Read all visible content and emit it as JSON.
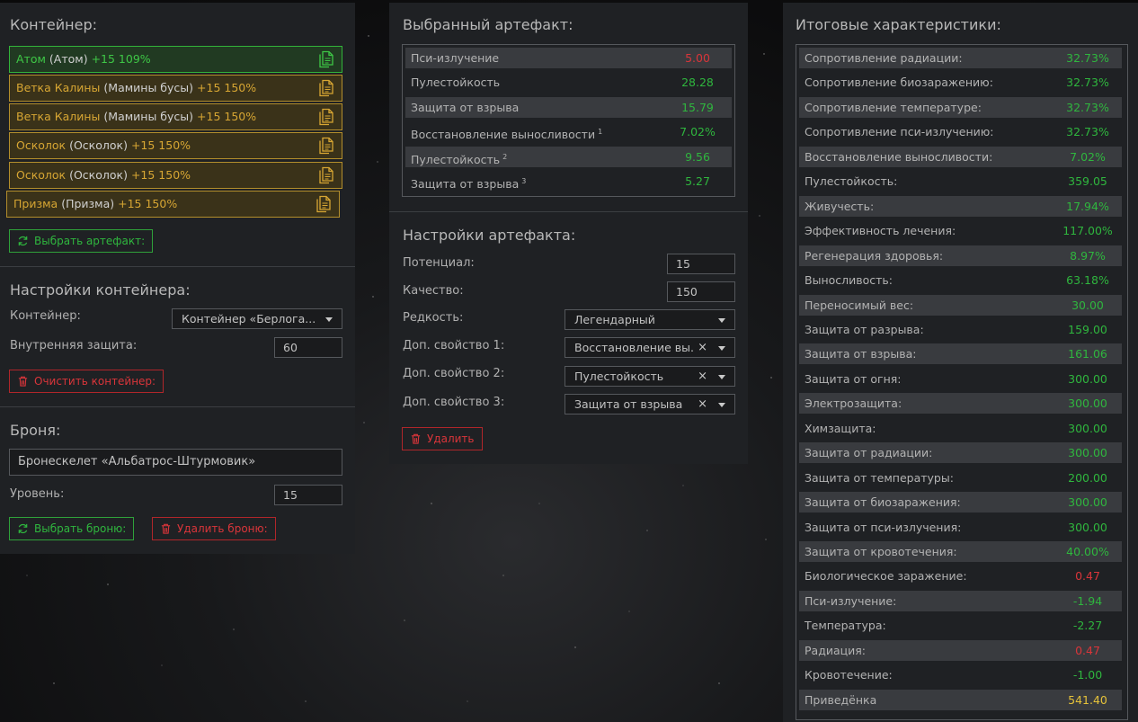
{
  "container_panel": {
    "title": "Контейнер:",
    "items": [
      {
        "name": "Атом",
        "sub": "(Атом)",
        "level": "+15 109%",
        "style": "green"
      },
      {
        "name": "Ветка Калины",
        "sub": "(Мамины бусы)",
        "level": "+15 150%",
        "style": "gold"
      },
      {
        "name": "Ветка Калины",
        "sub": "(Мамины бусы)",
        "level": "+15 150%",
        "style": "gold"
      },
      {
        "name": "Осколок",
        "sub": "(Осколок)",
        "level": "+15 150%",
        "style": "gold"
      },
      {
        "name": "Осколок",
        "sub": "(Осколок)",
        "level": "+15 150%",
        "style": "gold"
      },
      {
        "name": "Призма",
        "sub": "(Призма)",
        "level": "+15 150%",
        "style": "gold"
      }
    ],
    "select_artifact_label": "Выбрать артефакт:"
  },
  "container_settings": {
    "title": "Настройки контейнера:",
    "container_label": "Контейнер:",
    "container_value": "Контейнер «Берлога...",
    "inner_protection_label": "Внутренняя защита:",
    "inner_protection_value": "60",
    "clear_label": "Очистить контейнер:"
  },
  "armor": {
    "title": "Броня:",
    "armor_value": "Бронескелет «Альбатрос-Штурмовик»",
    "level_label": "Уровень:",
    "level_value": "15",
    "select_label": "Выбрать броню:",
    "delete_label": "Удалить броню:"
  },
  "selected_artifact": {
    "title": "Выбранный артефакт:",
    "rows": [
      {
        "name": "Пси-излучение",
        "sup": "",
        "value": "5.00",
        "tone": "neg"
      },
      {
        "name": "Пулестойкость",
        "sup": "",
        "value": "28.28",
        "tone": "pos"
      },
      {
        "name": "Защита от взрыва",
        "sup": "",
        "value": "15.79",
        "tone": "pos"
      },
      {
        "name": "Восстановление выносливости",
        "sup": "1",
        "value": "7.02%",
        "tone": "pos"
      },
      {
        "name": "Пулестойкость",
        "sup": "2",
        "value": "9.56",
        "tone": "pos"
      },
      {
        "name": "Защита от взрыва",
        "sup": "3",
        "value": "5.27",
        "tone": "pos"
      }
    ]
  },
  "artifact_settings": {
    "title": "Настройки артефакта:",
    "potential_label": "Потенциал:",
    "potential_value": "15",
    "quality_label": "Качество:",
    "quality_value": "150",
    "rarity_label": "Редкость:",
    "rarity_value": "Легендарный",
    "extra1_label": "Доп. свойство 1:",
    "extra1_value": "Восстановление вы...",
    "extra2_label": "Доп. свойство 2:",
    "extra2_value": "Пулестойкость",
    "extra3_label": "Доп. свойство 3:",
    "extra3_value": "Защита от взрыва",
    "clear_symbol": "×",
    "delete_label": "Удалить"
  },
  "totals": {
    "title": "Итоговые характеристики:",
    "rows": [
      {
        "name": "Сопротивление радиации:",
        "value": "32.73%",
        "tone": "pos"
      },
      {
        "name": "Сопротивление биозаражению:",
        "value": "32.73%",
        "tone": "pos"
      },
      {
        "name": "Сопротивление температуре:",
        "value": "32.73%",
        "tone": "pos"
      },
      {
        "name": "Сопротивление пси-излучению:",
        "value": "32.73%",
        "tone": "pos"
      },
      {
        "name": "Восстановление выносливости:",
        "value": "7.02%",
        "tone": "pos"
      },
      {
        "name": "Пулестойкость:",
        "value": "359.05",
        "tone": "pos"
      },
      {
        "name": "Живучесть:",
        "value": "17.94%",
        "tone": "pos"
      },
      {
        "name": "Эффективность лечения:",
        "value": "117.00%",
        "tone": "pos"
      },
      {
        "name": "Регенерация здоровья:",
        "value": "8.97%",
        "tone": "pos"
      },
      {
        "name": "Выносливость:",
        "value": "63.18%",
        "tone": "pos"
      },
      {
        "name": "Переносимый вес:",
        "value": "30.00",
        "tone": "pos"
      },
      {
        "name": "Защита от разрыва:",
        "value": "159.00",
        "tone": "pos"
      },
      {
        "name": "Защита от взрыва:",
        "value": "161.06",
        "tone": "pos"
      },
      {
        "name": "Защита от огня:",
        "value": "300.00",
        "tone": "pos"
      },
      {
        "name": "Электрозащита:",
        "value": "300.00",
        "tone": "pos"
      },
      {
        "name": "Химзащита:",
        "value": "300.00",
        "tone": "pos"
      },
      {
        "name": "Защита от радиации:",
        "value": "300.00",
        "tone": "pos"
      },
      {
        "name": "Защита от температуры:",
        "value": "200.00",
        "tone": "pos"
      },
      {
        "name": "Защита от биозаражения:",
        "value": "300.00",
        "tone": "pos"
      },
      {
        "name": "Защита от пси-излучения:",
        "value": "300.00",
        "tone": "pos"
      },
      {
        "name": "Защита от кровотечения:",
        "value": "40.00%",
        "tone": "pos"
      },
      {
        "name": "Биологическое заражение:",
        "value": "0.47",
        "tone": "neg"
      },
      {
        "name": "Пси-излучение:",
        "value": "-1.94",
        "tone": "pos"
      },
      {
        "name": "Температура:",
        "value": "-2.27",
        "tone": "pos"
      },
      {
        "name": "Радиация:",
        "value": "0.47",
        "tone": "neg"
      },
      {
        "name": "Кровотечение:",
        "value": "-1.00",
        "tone": "pos"
      },
      {
        "name": "Приведёнка",
        "value": "541.40",
        "tone": "gold"
      }
    ]
  },
  "icons": {
    "copy": "copy-icon",
    "refresh": "refresh-icon",
    "trash": "trash-icon",
    "chevron": "chevron-down-icon"
  },
  "colors": {
    "positive": "#2fb63e",
    "negative": "#d9353a",
    "gold": "#d7a633",
    "panel": "#1f2124"
  }
}
